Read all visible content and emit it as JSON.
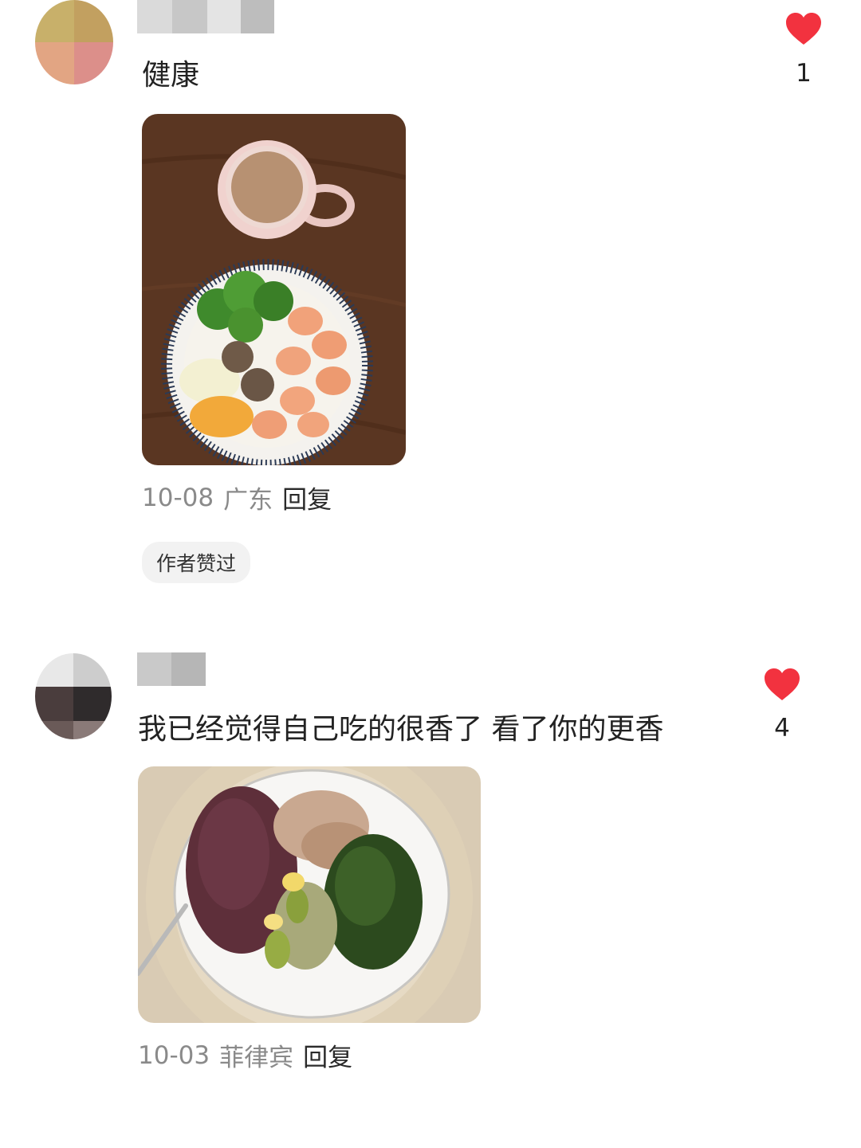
{
  "comments": [
    {
      "text": "健康",
      "likes": "1",
      "date": "10-08",
      "location": "广东",
      "reply_label": "回复",
      "badge": "作者赞过",
      "heart_icon": "heart-icon",
      "like_color": "#f2323f"
    },
    {
      "text": "我已经觉得自己吃的很香了 看了你的更香",
      "likes": "4",
      "date": "10-03",
      "location": "菲律宾",
      "reply_label": "回复",
      "heart_icon": "heart-icon",
      "like_color": "#f2323f"
    }
  ]
}
